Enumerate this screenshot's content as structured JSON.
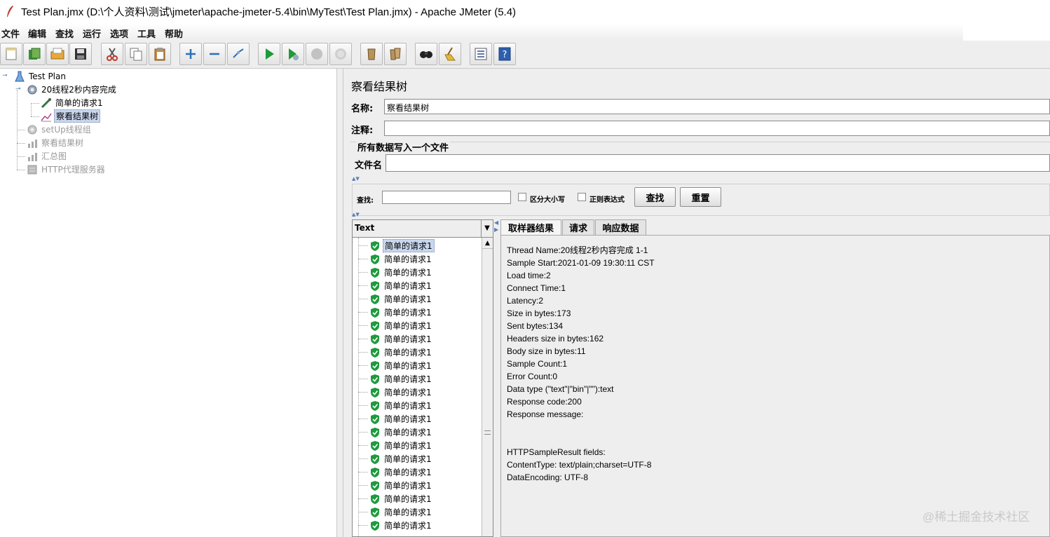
{
  "window": {
    "title": "Test Plan.jmx (D:\\个人资料\\测试\\jmeter\\apache-jmeter-5.4\\bin\\MyTest\\Test Plan.jmx) - Apache JMeter (5.4)"
  },
  "menu": [
    "文件",
    "编辑",
    "查找",
    "运行",
    "选项",
    "工具",
    "帮助"
  ],
  "toolbar": [
    {
      "icon": "new-icon"
    },
    {
      "icon": "templates-icon"
    },
    {
      "icon": "open-icon"
    },
    {
      "icon": "save-icon"
    },
    {
      "icon": "cut-icon"
    },
    {
      "icon": "copy-icon"
    },
    {
      "icon": "paste-icon"
    },
    {
      "icon": "expand-icon"
    },
    {
      "icon": "collapse-icon"
    },
    {
      "icon": "toggle-icon"
    },
    {
      "icon": "start-icon"
    },
    {
      "icon": "start-no-pause-icon"
    },
    {
      "icon": "stop-icon"
    },
    {
      "icon": "shutdown-icon"
    },
    {
      "icon": "clear-icon"
    },
    {
      "icon": "clear-all-icon"
    },
    {
      "icon": "search-icon"
    },
    {
      "icon": "reset-search-icon"
    },
    {
      "icon": "function-helper-icon"
    },
    {
      "icon": "help-icon"
    }
  ],
  "tree": {
    "root": "Test Plan",
    "thread_group": "20线程2秒内容完成",
    "sampler": "简单的请求1",
    "listener_selected": "察看结果树",
    "disabled_setup": "setUp线程组",
    "disabled_view": "察看结果树",
    "disabled_summary": "汇总图",
    "disabled_proxy": "HTTP代理服务器"
  },
  "panel": {
    "title": "察看结果树",
    "name_label": "名称:",
    "name_value": "察看结果树",
    "comment_label": "注释:",
    "comment_value": "",
    "file_group_title": "所有数据写入一个文件",
    "filename_label": "文件名",
    "filename_value": ""
  },
  "search": {
    "label": "查找:",
    "value": "",
    "case_sensitive": "区分大小写",
    "regex": "正则表达式",
    "find_button": "查找",
    "reset_button": "重置"
  },
  "results": {
    "renderer": "Text",
    "item_label": "简单的请求1",
    "visible_count": 22
  },
  "tabs": [
    "取样器结果",
    "请求",
    "响应数据"
  ],
  "sampler_result": {
    "lines": [
      "Thread Name:20线程2秒内容完成 1-1",
      "Sample Start:2021-01-09 19:30:11 CST",
      "Load time:2",
      "Connect Time:1",
      "Latency:2",
      "Size in bytes:173",
      "Sent bytes:134",
      "Headers size in bytes:162",
      "Body size in bytes:11",
      "Sample Count:1",
      "Error Count:0",
      "Data type (\"text\"|\"bin\"|\"\"):text",
      "Response code:200",
      "Response message:",
      "",
      "",
      "HTTPSampleResult fields:",
      "ContentType: text/plain;charset=UTF-8",
      "DataEncoding: UTF-8"
    ]
  },
  "watermark": "@稀土掘金技术社区"
}
